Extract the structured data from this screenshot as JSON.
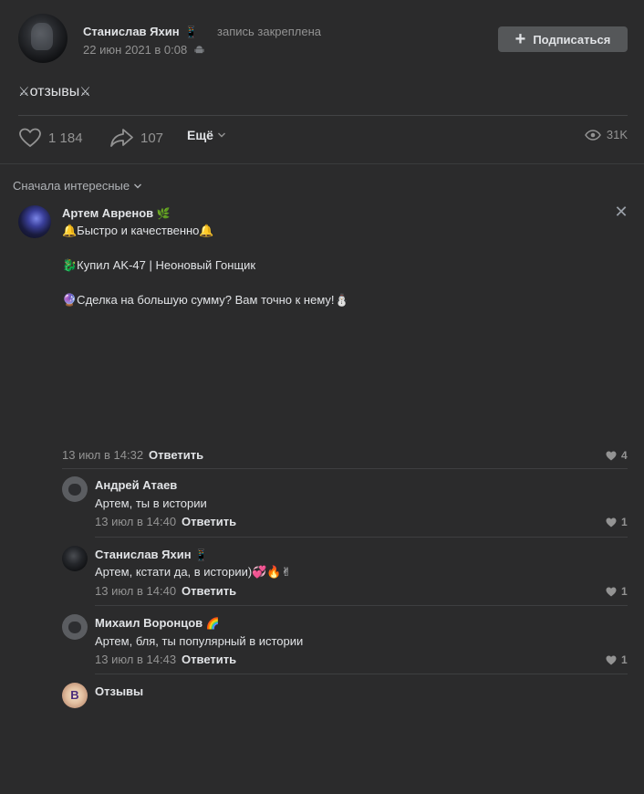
{
  "post": {
    "author": "Станислав Яхин",
    "author_badge": "📱",
    "pinned": "запись закреплена",
    "date": "22 июн 2021 в 0:08",
    "subscribe_label": "Подписаться",
    "text": "отзывы",
    "text_decoration": "⚔",
    "likes": "1 184",
    "shares": "107",
    "more_label": "Ещё",
    "views": "31K"
  },
  "comments_sort": "Сначала интересные",
  "comments": [
    {
      "author": "Артем Авренов",
      "author_badge": "🌿",
      "lines": [
        "🔔Быстро и качественно🔔",
        "🐉Купил AK-47 | Неоновый Гонщик",
        "🔮Сделка на большую сумму? Вам точно к нему!⛄"
      ],
      "date": "13 июл в 14:32",
      "reply_label": "Ответить",
      "likes": "4"
    }
  ],
  "replies": [
    {
      "author": "Андрей Атаев",
      "badge": "",
      "text": "Артем, ты в истории",
      "date": "13 июл в 14:40",
      "reply_label": "Ответить",
      "likes": "1"
    },
    {
      "author": "Станислав Яхин",
      "badge": "📱",
      "text": "Артем, кстати да, в истории)💞🔥✌",
      "date": "13 июл в 14:40",
      "reply_label": "Ответить",
      "likes": "1"
    },
    {
      "author": "Михаил Воронцов",
      "badge": "🌈",
      "text": "Артем, бля, ты популярный в истории",
      "date": "13 июл в 14:43",
      "reply_label": "Ответить",
      "likes": "1"
    },
    {
      "author": "Отзывы",
      "badge": "",
      "text": "",
      "date": "",
      "reply_label": "",
      "likes": ""
    }
  ],
  "colors": {
    "background": "#2b2b2c",
    "text": "#e1e3e6",
    "muted": "#939393",
    "button": "#555759"
  }
}
